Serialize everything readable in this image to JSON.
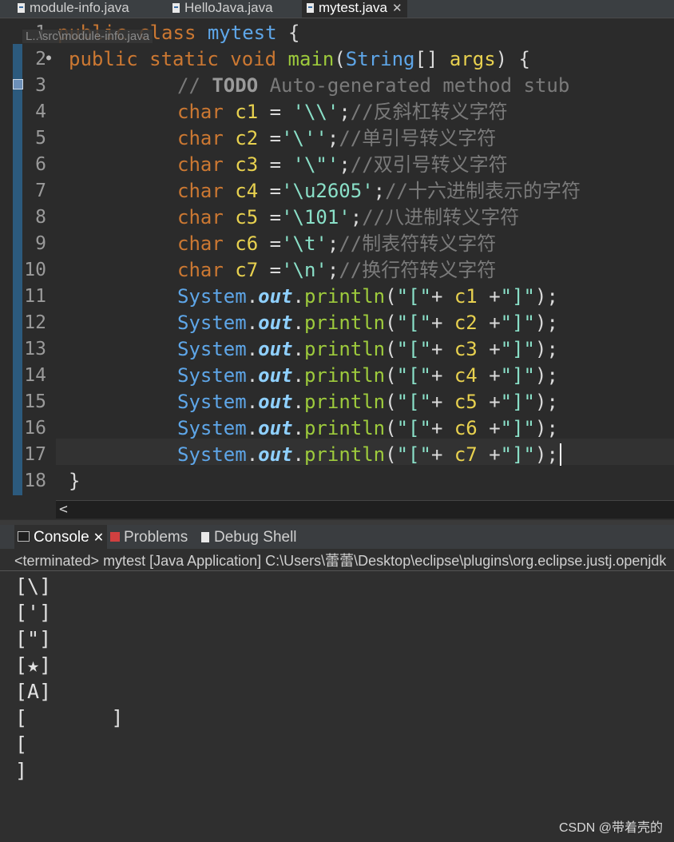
{
  "tabs": [
    {
      "label": "module-info.java",
      "active": false
    },
    {
      "label": "HelloJava.java",
      "active": false
    },
    {
      "label": "mytest.java",
      "active": true,
      "close": "✕"
    }
  ],
  "editor": {
    "breadcrumb": "L..\\src\\module-info.java",
    "line_numbers": [
      "1",
      "2",
      "3",
      "4",
      "5",
      "6",
      "7",
      "8",
      "9",
      "10",
      "11",
      "12",
      "13",
      "14",
      "15",
      "16",
      "17",
      "18"
    ],
    "lines": {
      "l1": {
        "kw1": "public",
        "kw2": "class",
        "cls": "mytest",
        "tail": " {"
      },
      "l2": {
        "kw": "public static void",
        "meth": "main",
        "p1": "(",
        "cls": "String",
        "p2": "[] ",
        "var": "args",
        "p3": ") {"
      },
      "l3": {
        "c1": "// ",
        "todo": "TODO",
        "c2": " Auto-generated method stub"
      },
      "l4": {
        "kw": "char",
        "var": "c1",
        "eq": " = ",
        "str": "'\\\\'",
        "tail": ";",
        "cmt": "//反斜杠转义字符"
      },
      "l5": {
        "kw": "char",
        "var": "c2",
        "eq": " =",
        "str": "'\\''",
        "tail": ";",
        "cmt": "//单引号转义字符"
      },
      "l6": {
        "kw": "char",
        "var": "c3",
        "eq": " = ",
        "str": "'\\\"'",
        "tail": ";",
        "cmt": "//双引号转义字符"
      },
      "l7": {
        "kw": "char",
        "var": "c4",
        "eq": " =",
        "str": "'\\u2605'",
        "tail": ";",
        "cmt": "//十六进制表示的字符"
      },
      "l8": {
        "kw": "char",
        "var": "c5",
        "eq": " =",
        "str": "'\\101'",
        "tail": ";",
        "cmt": "//八进制转义字符"
      },
      "l9": {
        "kw": "char",
        "var": "c6",
        "eq": " =",
        "str": "'\\t'",
        "tail": ";",
        "cmt": "//制表符转义字符"
      },
      "l10": {
        "kw": "char",
        "var": "c7",
        "eq": " =",
        "str": "'\\n'",
        "tail": ";",
        "cmt": "//换行符转义字符"
      },
      "println": {
        "cls": "System",
        "dot1": ".",
        "fld": "out",
        "dot2": ".",
        "meth": "println",
        "p1": "(",
        "s1": "\"[\"",
        "plus1": "+ ",
        "plus2": " +",
        "s2": "\"]\"",
        "p2": ");",
        "vars": [
          "c1",
          "c2",
          "c3",
          "c4",
          "c5",
          "c6",
          "c7"
        ]
      },
      "l18": {
        "text": "}"
      }
    },
    "hscroll_arrow": "<"
  },
  "console": {
    "tabs": [
      {
        "label": "Console",
        "close": "✕"
      },
      {
        "label": "Problems"
      },
      {
        "label": "Debug Shell"
      }
    ],
    "status": "<terminated> mytest [Java Application] C:\\Users\\蕾蕾\\Desktop\\eclipse\\plugins\\org.eclipse.justj.openjdk",
    "output": [
      "[\\]",
      "[']",
      "[\"]",
      "[★]",
      "[A]",
      "[\t]",
      "[",
      "]"
    ]
  },
  "watermark": "CSDN @带着壳的",
  "colors": {
    "keyword": "#cc7832",
    "class": "#5ea6e8",
    "method": "#9ecb3c",
    "variable": "#e8d14f",
    "string": "#8ae0c8",
    "comment": "#7a7a7a"
  }
}
